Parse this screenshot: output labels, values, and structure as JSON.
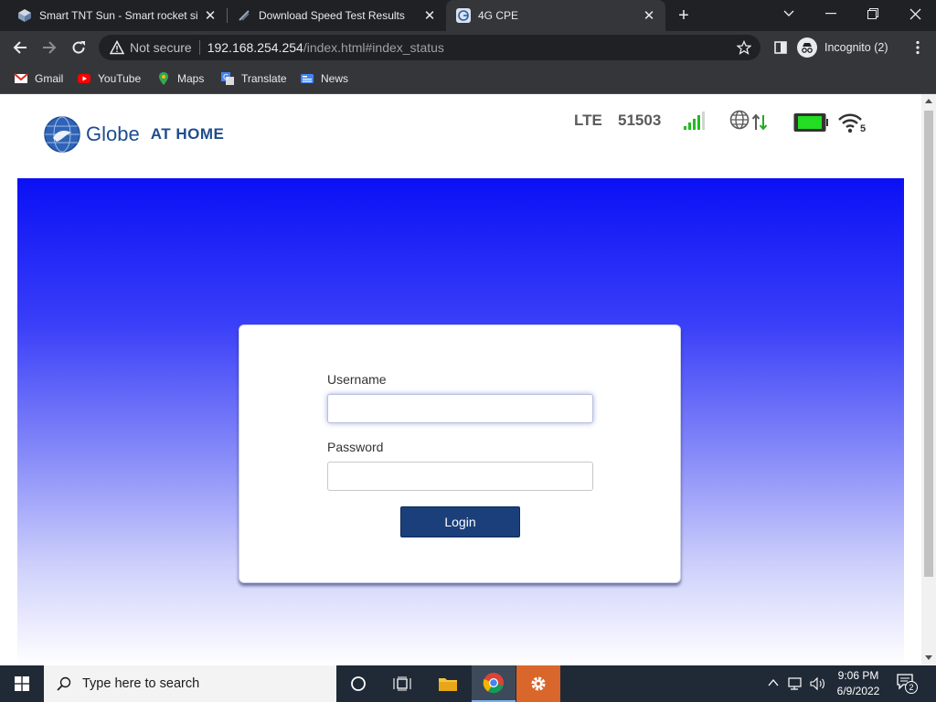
{
  "browser": {
    "tabs": [
      {
        "title": "Smart TNT Sun - Smart rocket sim",
        "icon": "router-cube-icon"
      },
      {
        "title": "Download Speed Test Results",
        "icon": "speedtest-icon"
      },
      {
        "title": "4G CPE",
        "icon": "globe-favicon-icon"
      }
    ],
    "security_label": "Not secure",
    "url_host": "192.168.254.254",
    "url_path": "/index.html#index_status",
    "profile_label": "Incognito (2)",
    "bookmarks": [
      {
        "label": "Gmail",
        "icon": "gmail-icon"
      },
      {
        "label": "YouTube",
        "icon": "youtube-icon"
      },
      {
        "label": "Maps",
        "icon": "maps-icon"
      },
      {
        "label": "Translate",
        "icon": "translate-icon"
      },
      {
        "label": "News",
        "icon": "news-icon"
      }
    ]
  },
  "header": {
    "logo_word": "Globe",
    "logo_tag": "AT HOME",
    "network_type": "LTE",
    "plmn": "51503",
    "signal_level": 4,
    "wifi_clients": "5",
    "colors": {
      "brand": "#1f4d8c",
      "battery": "#22dd22",
      "signal": "#22bb22"
    }
  },
  "login": {
    "username_label": "Username",
    "username_value": "",
    "password_label": "Password",
    "password_value": "",
    "button_label": "Login",
    "colors": {
      "button": "#1b3f7a"
    }
  },
  "taskbar": {
    "search_placeholder": "Type here to search",
    "time": "9:06 PM",
    "date": "6/9/2022",
    "notification_count": "2"
  }
}
